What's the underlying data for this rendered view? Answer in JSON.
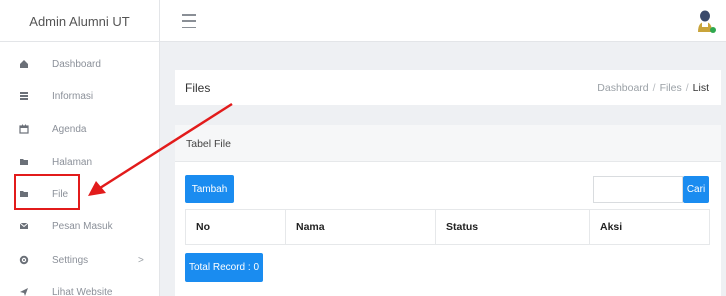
{
  "brand": {
    "title": "Admin Alumni UT"
  },
  "topbar": {
    "menu_icon": "hamburger-icon",
    "avatar_icon": "user-avatar-icon"
  },
  "sidebar": {
    "items": [
      {
        "label": "Dashboard",
        "icon": "dashboard-icon"
      },
      {
        "label": "Informasi",
        "icon": "list-icon"
      },
      {
        "label": "Agenda",
        "icon": "calendar-icon"
      },
      {
        "label": "Halaman",
        "icon": "folder-icon"
      },
      {
        "label": "File",
        "icon": "folder-icon"
      },
      {
        "label": "Pesan Masuk",
        "icon": "mail-icon"
      },
      {
        "label": "Settings",
        "icon": "gear-icon",
        "chevron": ">"
      },
      {
        "label": "Lihat Website",
        "icon": "send-icon"
      }
    ]
  },
  "header": {
    "title": "Files",
    "breadcrumb": {
      "item1": "Dashboard",
      "item2": "Files",
      "active": "List",
      "separator": "/"
    }
  },
  "card": {
    "title": "Tabel File",
    "add_button": "Tambah",
    "search": {
      "value": "",
      "placeholder": ""
    },
    "search_button": "Cari",
    "columns": [
      "No",
      "Nama",
      "Status",
      "Aksi"
    ],
    "total_record": "Total Record : 0"
  },
  "colors": {
    "primary": "#1a8cf0",
    "annotation": "#e21b1b",
    "background": "#eef0f3"
  }
}
